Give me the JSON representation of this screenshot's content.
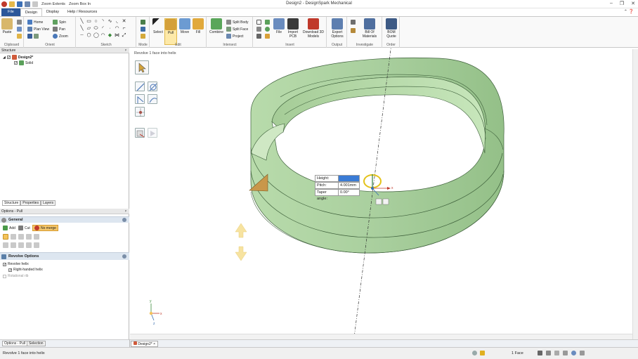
{
  "titlebar": {
    "quick_zoom_extents": "Zoom Extents",
    "quick_zoom_box": "Zoom Box In",
    "title": "Design2 - DesignSpark Mechanical"
  },
  "tabs": [
    {
      "label": "File"
    },
    {
      "label": "Design"
    },
    {
      "label": "Display"
    },
    {
      "label": "Help / Resources"
    }
  ],
  "ribbon": {
    "clipboard": {
      "label": "Clipboard",
      "paste": "Paste"
    },
    "orient": {
      "label": "Orient",
      "home": "Home",
      "spin": "Spin",
      "plan_view": "Plan View",
      "pan": "Pan",
      "zoom": "Zoom"
    },
    "sketch": {
      "label": "Sketch"
    },
    "mode": {
      "label": "Mode"
    },
    "edit": {
      "label": "Edit",
      "select": "Select",
      "pull": "Pull",
      "move": "Move",
      "fill": "Fill"
    },
    "intersect": {
      "label": "Intersect",
      "combine": "Combine",
      "split_body": "Split Body",
      "split_face": "Split Face",
      "project": "Project"
    },
    "insert": {
      "label": "Insert",
      "file": "File",
      "import_pcb": "Import PCB",
      "download_3d": "Download 3D Models"
    },
    "output": {
      "label": "Output",
      "export": "Export Options"
    },
    "investigate": {
      "label": "Investigate",
      "bom": "Bill Of Materials"
    },
    "order": {
      "label": "Order",
      "bom_quote": "BOM Quote"
    }
  },
  "structure": {
    "header": "Structure",
    "root": "Design2*",
    "child": "Solid"
  },
  "panel_tabs": [
    "Structure",
    "Properties",
    "Layers"
  ],
  "options": {
    "header": "Options - Pull",
    "general": "General",
    "add": "Add",
    "cut": "Cut",
    "no_merge": "No merge",
    "revolve_header": "Revolve Options",
    "revolve_helix": "Revolve helix",
    "right_handed": "Right-handed helix",
    "rotational_rib": "Rotational rib"
  },
  "viewport": {
    "hint": "Revolve 1 face into helix"
  },
  "hud": {
    "height_label": "Height:",
    "height_value": "",
    "pitch_label": "Pitch:",
    "pitch_value": "4.001mm",
    "taper_label": "Taper angle:",
    "taper_value": "0.00°"
  },
  "bottom_tabs": [
    "Options - Pull",
    "Selection"
  ],
  "doc_tab": "Design2*",
  "status": {
    "text": "Revolve 1 face into helix",
    "face_count": "1 Face"
  },
  "colors": {
    "ribbon_file": "#2b579a",
    "part": "#a9cf9e",
    "part_dark": "#8fbd83",
    "inner": "#bfe0b3"
  }
}
